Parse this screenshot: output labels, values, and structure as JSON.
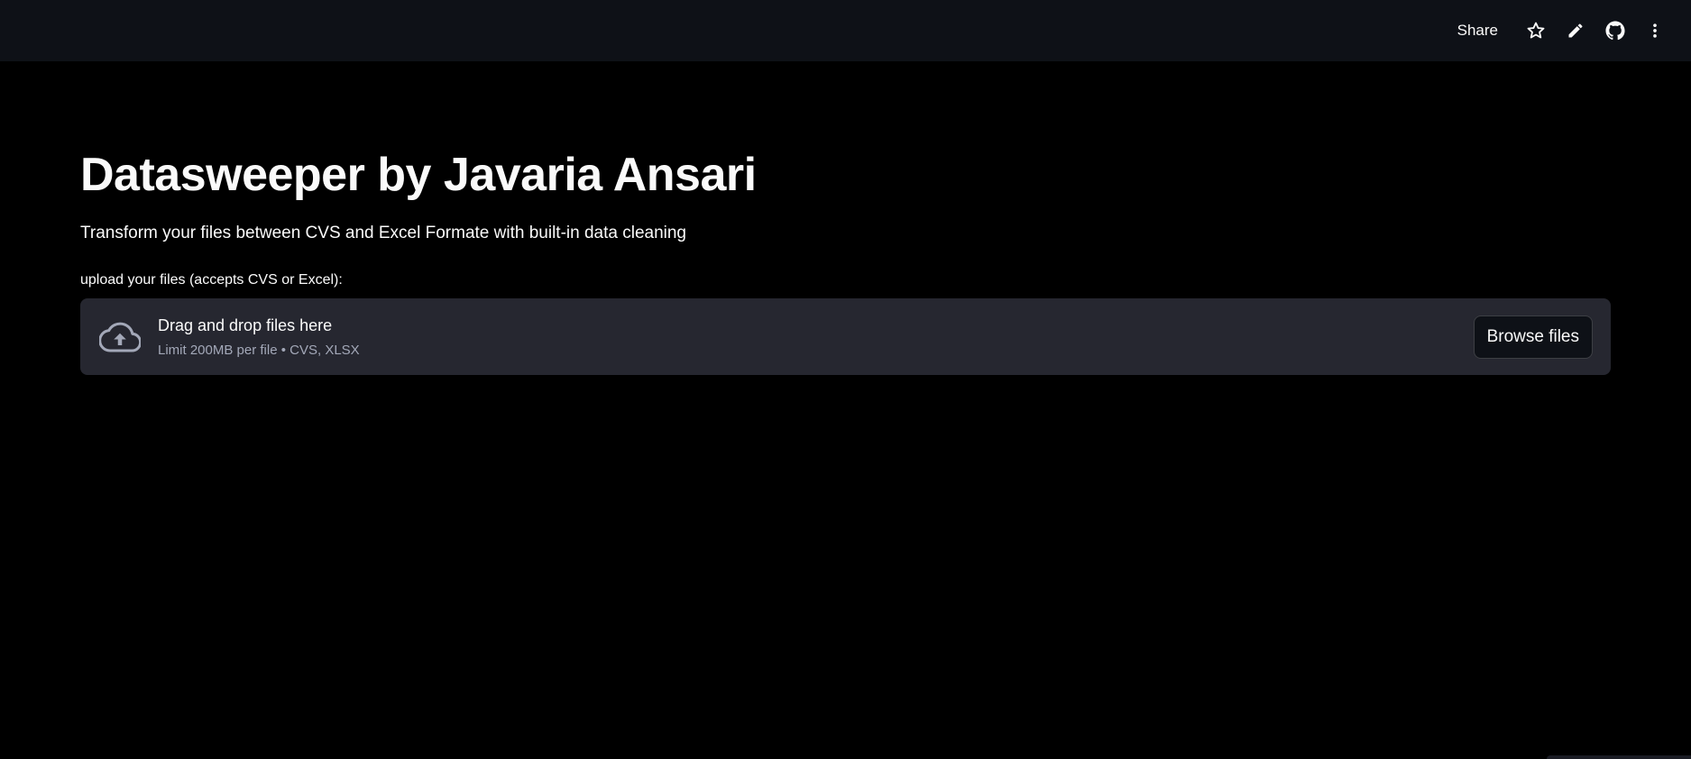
{
  "header": {
    "share_label": "Share",
    "icons": [
      "star-icon",
      "pencil-icon",
      "github-icon",
      "more-vertical-icon"
    ]
  },
  "main": {
    "title": "Datasweeper by Javaria Ansari",
    "subtitle": "Transform your files between CVS and Excel Formate with built-in data cleaning",
    "uploader": {
      "label": "upload your files (accepts CVS or Excel):",
      "drop_title": "Drag and drop files here",
      "limit_text": "Limit 200MB per file • CVS, XLSX",
      "browse_label": "Browse files",
      "icon": "cloud-upload-icon"
    }
  },
  "colors": {
    "background": "#000000",
    "header_bg": "#0e1117",
    "dropzone_bg": "#262730",
    "text": "#fafafa",
    "muted_text": "#a3a8b8"
  }
}
